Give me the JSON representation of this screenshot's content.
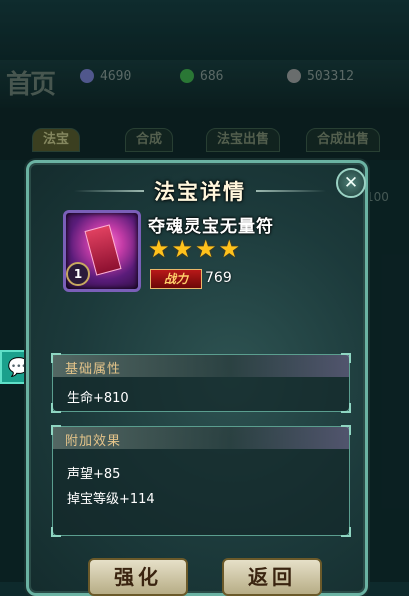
{
  "background": {
    "home_label": "首页",
    "resources": [
      {
        "icon": "crystal-icon",
        "value": "4690",
        "color": "#7a7fd0"
      },
      {
        "icon": "jade-icon",
        "value": "686",
        "color": "#3fb04a"
      },
      {
        "icon": "coin-icon",
        "value": "503312",
        "color": "#a0a0a0"
      }
    ],
    "tabs": [
      "法宝",
      "合成",
      "法宝出售",
      "合成出售"
    ],
    "side_number": "100"
  },
  "modal": {
    "title": "法宝详情",
    "close_label": "✕",
    "item": {
      "name": "夺魂灵宝无量符",
      "level": "1",
      "stars": 4,
      "power_label": "战力",
      "power_value": "769"
    },
    "base_section": {
      "header": "基础属性",
      "rows": [
        "生命+810"
      ]
    },
    "extra_section": {
      "header": "附加效果",
      "rows": [
        "声望+85",
        "掉宝等级+114"
      ]
    },
    "buttons": {
      "strengthen": "强化",
      "back": "返回"
    }
  },
  "colors": {
    "star": "#ffc21c",
    "panel_border": "#5b9e8f",
    "header_text": "#e4c48a"
  }
}
